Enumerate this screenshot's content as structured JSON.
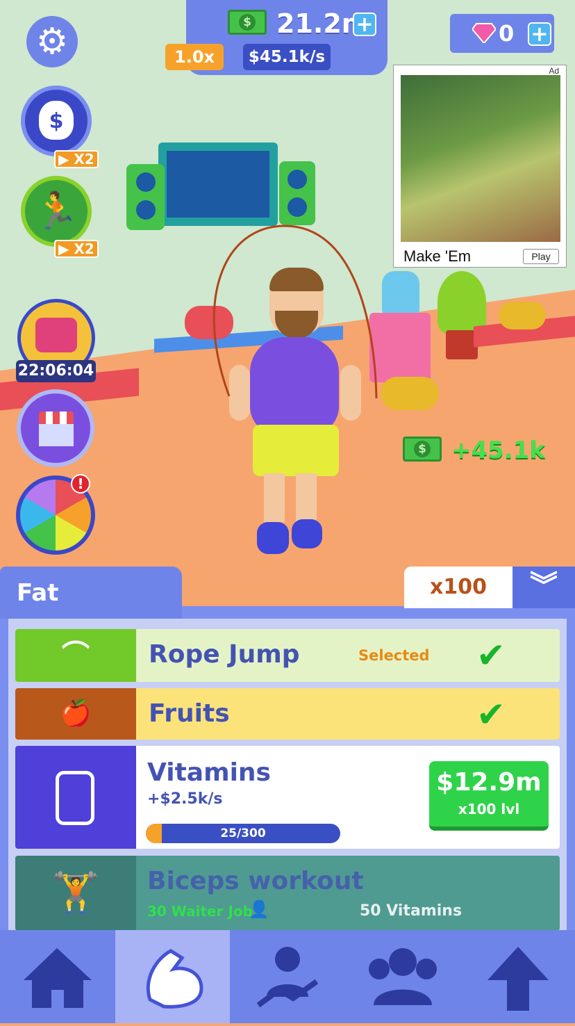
{
  "top_bar": {
    "money": "21.2m",
    "multiplier": "1.0x",
    "rate": "$45.1k/s",
    "gems": "0"
  },
  "left_buttons": [
    {
      "icon": "gear-icon"
    },
    {
      "icon": "money-bag-icon",
      "tag": "X2"
    },
    {
      "icon": "runner-icon",
      "tag": "X2"
    },
    {
      "icon": "gem-chest-icon",
      "timer": "22:06:04"
    },
    {
      "icon": "shop-icon"
    },
    {
      "icon": "spin-wheel-icon",
      "alert": "!"
    }
  ],
  "ad": {
    "badge": "Ad",
    "title": "Make 'Em",
    "button": "Play"
  },
  "floating_income": "+45.1k",
  "tabs": {
    "category": "Fat",
    "multiplier": "x100"
  },
  "items": [
    {
      "name": "Rope Jump",
      "status": "Selected",
      "icon": "jump-rope-icon"
    },
    {
      "name": "Fruits",
      "icon": "fruits-icon"
    },
    {
      "name": "Vitamins",
      "income": "+$2.5k/s",
      "progress_text": "25/300",
      "progress": 0.083,
      "price": "$12.9m",
      "price_sub": "x100 lvl",
      "icon": "vitamin-jar-icon"
    },
    {
      "name": "Biceps workout",
      "req1": "30 Waiter Job",
      "req2": "50 Vitamins",
      "icon": "dumbbell-man-icon"
    }
  ],
  "nav": [
    "home-icon",
    "biceps-icon",
    "career-icon",
    "friends-icon",
    "upgrade-arrow-icon"
  ],
  "colors": {
    "accent": "#6f84e8",
    "buy_green": "#2fd34a",
    "check_green": "#18b52a",
    "selected_orange": "#e98a13"
  }
}
